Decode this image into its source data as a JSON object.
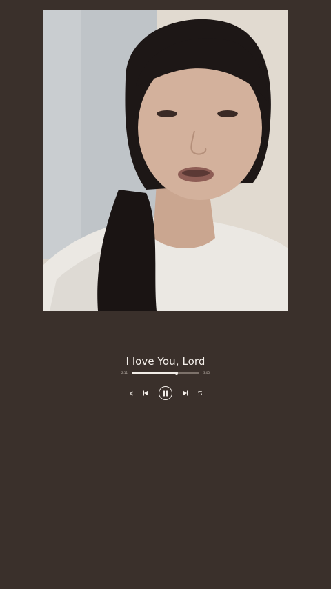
{
  "track": {
    "title": "I love You, Lord",
    "elapsed": "2:11",
    "duration": "3:05",
    "progress_fraction": 0.66
  },
  "controls": {
    "shuffle_icon": "shuffle-icon",
    "previous_icon": "skip-previous-icon",
    "pause_icon": "pause-icon",
    "next_icon": "skip-next-icon",
    "repeat_icon": "repeat-icon"
  },
  "colors": {
    "background": "#3a302b",
    "text": "#f4efea",
    "track_fill": "#f2ede8",
    "track_empty": "#7c716a"
  }
}
